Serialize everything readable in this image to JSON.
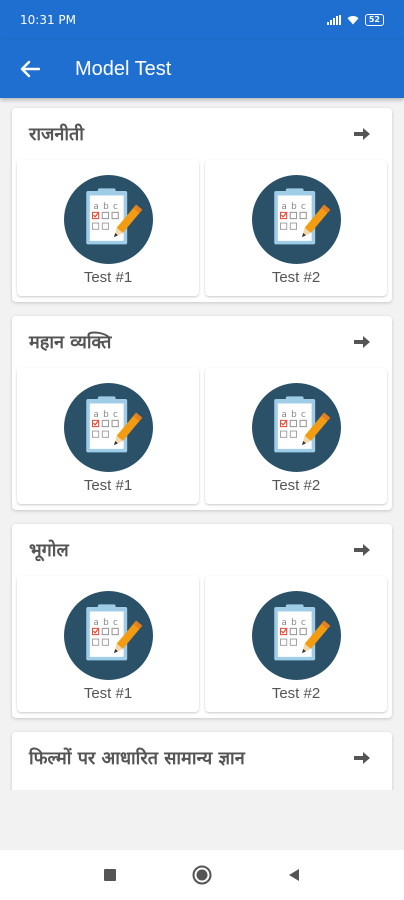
{
  "status_bar": {
    "time": "10:31 PM",
    "battery": "52"
  },
  "app_bar": {
    "title": "Model Test",
    "back_icon": "arrow-left-icon",
    "color": "#1e6fd0"
  },
  "sections": [
    {
      "title": "राजनीती",
      "arrow_icon": "arrow-right-icon",
      "tests": [
        {
          "label": "Test #1",
          "icon": "quiz-clipboard-icon"
        },
        {
          "label": "Test #2",
          "icon": "quiz-clipboard-icon"
        }
      ]
    },
    {
      "title": "महान व्यक्ति",
      "arrow_icon": "arrow-right-icon",
      "tests": [
        {
          "label": "Test #1",
          "icon": "quiz-clipboard-icon"
        },
        {
          "label": "Test #2",
          "icon": "quiz-clipboard-icon"
        }
      ]
    },
    {
      "title": "भूगोल",
      "arrow_icon": "arrow-right-icon",
      "tests": [
        {
          "label": "Test #1",
          "icon": "quiz-clipboard-icon"
        },
        {
          "label": "Test #2",
          "icon": "quiz-clipboard-icon"
        }
      ]
    },
    {
      "title": "फिल्मों पर आधारित सामान्य ज्ञान",
      "arrow_icon": "arrow-right-icon",
      "tests": []
    }
  ],
  "nav_bar": {
    "recents_icon": "square-icon",
    "home_icon": "circle-icon",
    "back_icon": "triangle-back-icon"
  }
}
